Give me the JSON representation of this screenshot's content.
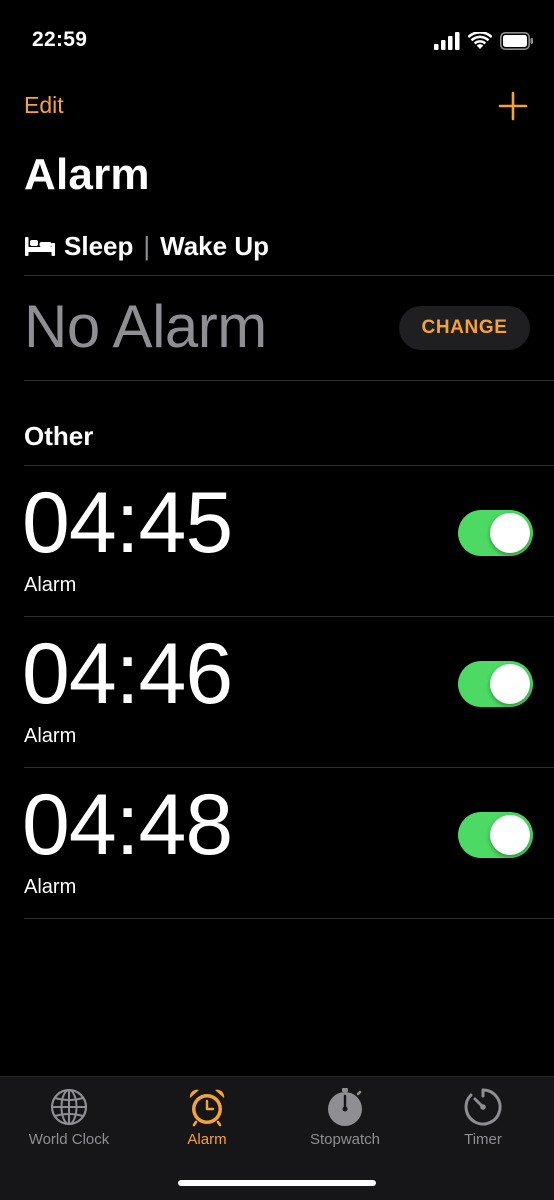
{
  "status_bar": {
    "time": "22:59",
    "icons": [
      "cellular-signal-icon",
      "wifi-icon",
      "battery-icon"
    ]
  },
  "nav": {
    "edit_label": "Edit",
    "add_icon": "plus-icon"
  },
  "title": "Alarm",
  "sleep": {
    "icon": "bed-icon",
    "sleep_label": "Sleep",
    "separator": "|",
    "wake_label": "Wake Up",
    "status": "No Alarm",
    "change_label": "CHANGE"
  },
  "other_header": "Other",
  "alarms": [
    {
      "time": "04:45",
      "label": "Alarm",
      "enabled": true
    },
    {
      "time": "04:46",
      "label": "Alarm",
      "enabled": true
    },
    {
      "time": "04:48",
      "label": "Alarm",
      "enabled": true
    }
  ],
  "tabs": [
    {
      "label": "World Clock",
      "icon": "globe-icon",
      "active": false
    },
    {
      "label": "Alarm",
      "icon": "alarm-clock-icon",
      "active": true
    },
    {
      "label": "Stopwatch",
      "icon": "stopwatch-icon",
      "active": false
    },
    {
      "label": "Timer",
      "icon": "timer-icon",
      "active": false
    }
  ],
  "colors": {
    "accent": "#f4a23c",
    "toggle_on": "#4cd964",
    "secondary_text": "#8e8e93",
    "background": "#000000"
  }
}
